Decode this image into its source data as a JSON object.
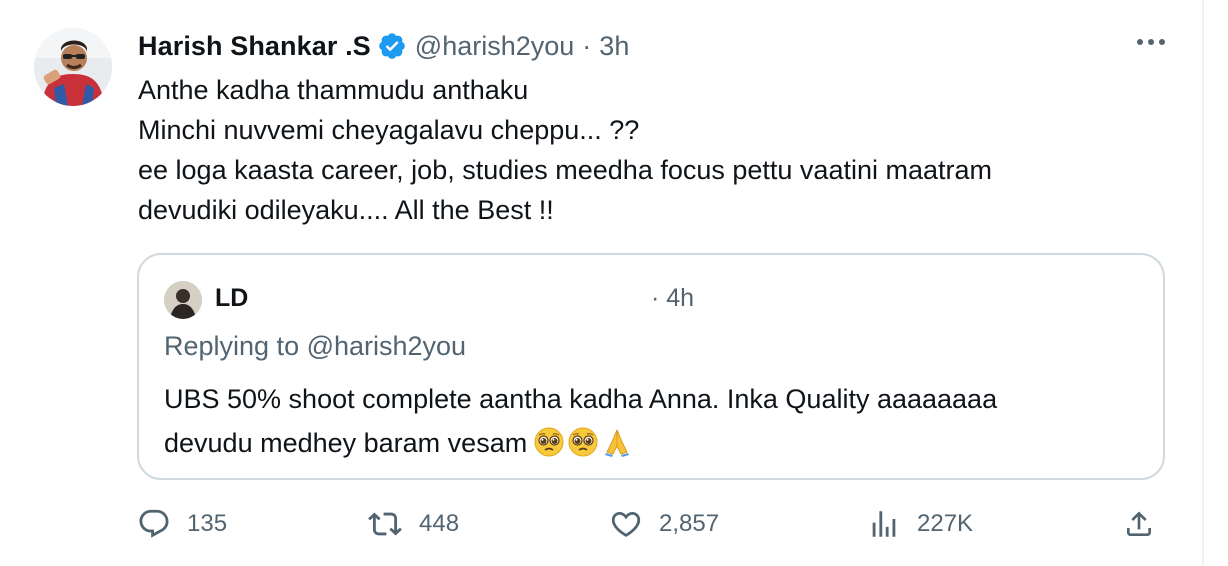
{
  "tweet": {
    "author_name": "Harish Shankar .S",
    "handle": "@harish2you",
    "separator": "·",
    "time": "3h",
    "text_lines": [
      "Anthe kadha thammudu anthaku",
      "Minchi nuvvemi cheyagalavu cheppu... ??",
      "ee loga kaasta career, job, studies meedha focus pettu vaatini maatram",
      "devudiki odileyaku.... All the Best !!"
    ],
    "more_icon": "ellipsis-icon",
    "verified_icon": "verified-badge-icon"
  },
  "quote": {
    "author_name": "LD",
    "time": "· 4h",
    "replying_to": "Replying to @harish2you",
    "text_lines": [
      "UBS 50% shoot complete aantha kadha Anna. Inka Quality aaaaaaaa",
      "devudu medhey baram vesam"
    ],
    "emojis": [
      "pleading-face-emoji",
      "pleading-face-emoji",
      "folded-hands-emoji"
    ]
  },
  "actions": {
    "replies": "135",
    "reposts": "448",
    "likes": "2,857",
    "views": "227K",
    "icons": [
      "reply-icon",
      "repost-icon",
      "like-icon",
      "views-icon",
      "share-icon"
    ]
  },
  "colors": {
    "text_primary": "#0f1419",
    "text_secondary": "#536471",
    "border": "#cfd9de",
    "verified": "#1d9bf0"
  }
}
